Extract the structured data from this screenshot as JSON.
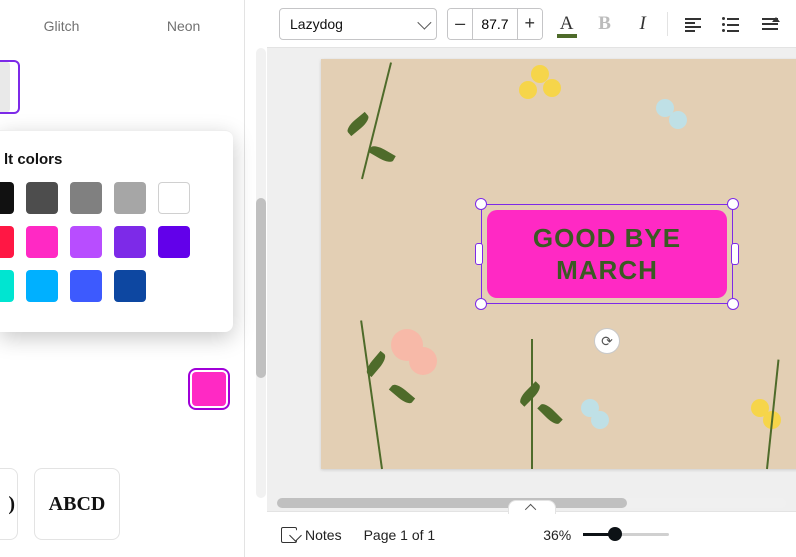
{
  "toolbar": {
    "font_name": "Lazydog",
    "font_size": "87.7",
    "text_color": "#4e6b2a"
  },
  "side": {
    "effect_tabs": {
      "glitch": "Glitch",
      "neon": "Neon"
    },
    "abcd_preview": "ABCD",
    "abcd_edge": ")",
    "color_group_label": "lt colors",
    "swatches_row1": [
      "#111111",
      "#4d4d4d",
      "#808080",
      "#a6a6a6",
      "#ffffff"
    ],
    "swatches_row2": [
      "#ff1744",
      "#ff29c4",
      "#b84dff",
      "#7d2ae8",
      "#6200ea"
    ],
    "swatches_row3": [
      "#00e5d1",
      "#00b0ff",
      "#3d5afe",
      "#0d47a1"
    ],
    "current_color": "#ff29c4"
  },
  "canvas": {
    "background": "#e3cfb4",
    "text_content": "GOOD BYE MARCH",
    "text_fill": "#ff29c4",
    "text_color": "#3a5a23",
    "selection_outline": "#7d2ae8"
  },
  "footer": {
    "notes_label": "Notes",
    "page_label": "Page 1 of 1",
    "zoom_label": "36%",
    "zoom_pct": 36
  }
}
